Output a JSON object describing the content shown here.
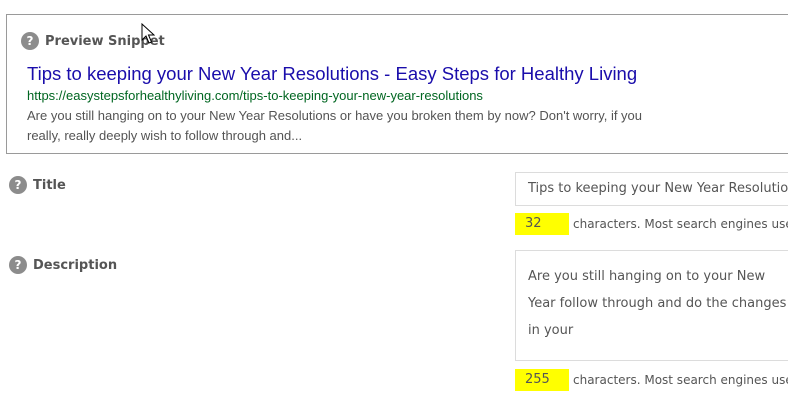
{
  "preview": {
    "heading": "Preview Snippet",
    "title": "Tips to keeping your New Year Resolutions - Easy Steps for Healthy Living",
    "url": "https://easystepsforhealthyliving.com/tips-to-keeping-your-new-year-resolutions",
    "description": "Are you still hanging on to your New Year Resolutions or have you broken them by now? Don't worry, if you really, really deeply wish to follow through and..."
  },
  "title_field": {
    "label": "Title",
    "value": "Tips to keeping your New Year Resolutions",
    "count": "32",
    "count_text": "characters. Most search engines use a"
  },
  "description_field": {
    "label": "Description",
    "value": "Are you still hanging on to your New Year follow through and do the changes in your",
    "count": "255",
    "count_text": "characters. Most search engines use a"
  },
  "icons": {
    "help": "?"
  },
  "colors": {
    "snippet_title": "#1a0dab",
    "snippet_url": "#006621",
    "counter_highlight": "#ffff00"
  }
}
